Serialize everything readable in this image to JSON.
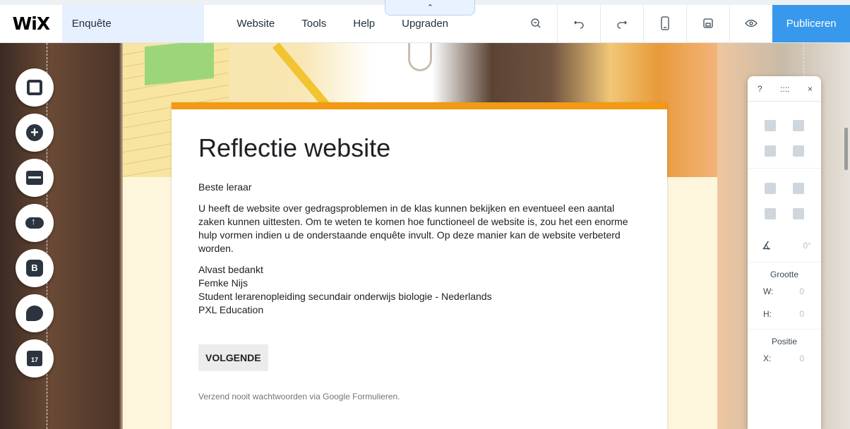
{
  "topbar": {
    "logo": "WiX",
    "site_name": "Enquête",
    "menu": [
      "Website",
      "Tools",
      "Help",
      "Upgraden"
    ],
    "upgrade_tab_glyph": "⌃",
    "tools": [
      "zoom-out-icon",
      "undo-icon",
      "redo-icon",
      "mobile-view-icon",
      "save-icon",
      "preview-icon"
    ],
    "publish_label": "Publiceren",
    "publish_color": "#3899ec"
  },
  "left_panel": {
    "buttons": [
      "background-icon",
      "add-icon",
      "store-icon",
      "upload-icon",
      "blog-icon",
      "chat-icon",
      "bookings-icon"
    ],
    "blog_letter": "B",
    "calendar_text": "17"
  },
  "form": {
    "accent_color": "#f29a13",
    "title": "Reflectie website",
    "greeting": "Beste leraar",
    "body": "U heeft de website over gedragsproblemen in de klas kunnen bekijken en eventueel een aantal zaken kunnen uittesten. Om te weten te komen hoe functioneel de website is, zou het een enorme hulp vormen indien u de onderstaande enquête invult. Op deze manier kan de website verbeterd worden.",
    "signature": [
      "Alvast bedankt",
      "Femke Nijs",
      "Student lerarenopleiding secundair onderwijs biologie - Nederlands",
      "PXL Education"
    ],
    "next_button": "VOLGENDE",
    "footnote": "Verzend nooit wachtwoorden via Google Formulieren."
  },
  "right_panel": {
    "help": "?",
    "drag": "::::",
    "close": "×",
    "angle_icon": "∡",
    "angle_value": "0°",
    "size_title": "Grootte",
    "w_label": "W:",
    "w_value": "0",
    "h_label": "H:",
    "h_value": "0",
    "position_title": "Positie",
    "x_label": "X:",
    "x_value": "0"
  }
}
